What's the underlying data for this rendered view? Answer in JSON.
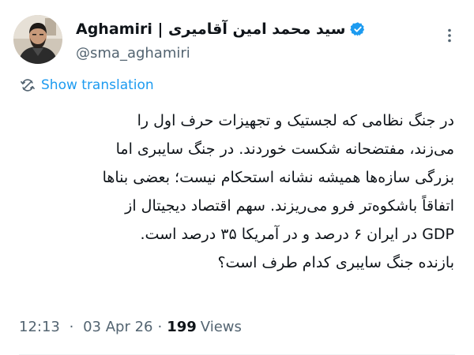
{
  "author": {
    "display_name": "Aghamiri | سید محمد امین آقامیری",
    "handle": "@sma_aghamiri",
    "verified": true,
    "verified_color": "#1d9bf0"
  },
  "actions": {
    "more_icon": "more-horizontal-icon",
    "translate_icon": "translate-icon",
    "translate_label": "Show translation",
    "link_color": "#1d9bf0"
  },
  "tweet": {
    "lines": [
      "در جنگ نظامی که لجستیک و تجهیزات حرف اول را",
      "می‌زند، مفتضحانه شکست خوردند. در جنگ سایبری اما",
      "بزرگی سازه‌ها همیشه نشانه استحکام نیست؛ بعضی بناها",
      "اتفاقاً باشکوه‌تر فرو می‌ریزند. سهم اقتصاد دیجیتال از",
      "GDP در ایران ۶ درصد و در آمریکا ۳۵ درصد است.",
      "بازنده جنگ سایبری کدام طرف است؟"
    ]
  },
  "meta": {
    "time": "12:13",
    "date": "03 Apr 26",
    "separator": "·",
    "views_count": "199",
    "views_label": "Views"
  }
}
